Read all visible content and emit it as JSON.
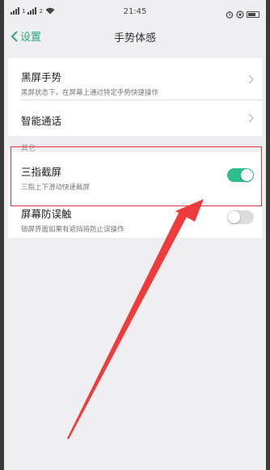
{
  "status_bar": {
    "signal_1": "1",
    "signal_2": "2",
    "time": "21:45",
    "right_icons": [
      "alarm-icon",
      "eye-protect-icon",
      "battery-icon"
    ]
  },
  "nav": {
    "back_label": "设置",
    "title": "手势体感"
  },
  "group1": {
    "items": [
      {
        "title": "黑屏手势",
        "subtitle": "黑屏状态下，在屏幕上通过特定手势快捷操作"
      },
      {
        "title": "智能通话"
      }
    ]
  },
  "section_other": {
    "label": "其它",
    "items": [
      {
        "title": "三指截屏",
        "subtitle": "三指上下滑动快速截屏",
        "enabled": true
      },
      {
        "title": "屏幕防误触",
        "subtitle": "锁屏界面如果有遮挡将防止误操作",
        "enabled": false
      }
    ]
  },
  "colors": {
    "accent": "#2aa87a",
    "toggle_on": "#2fbf8a",
    "highlight": "#e53935"
  }
}
